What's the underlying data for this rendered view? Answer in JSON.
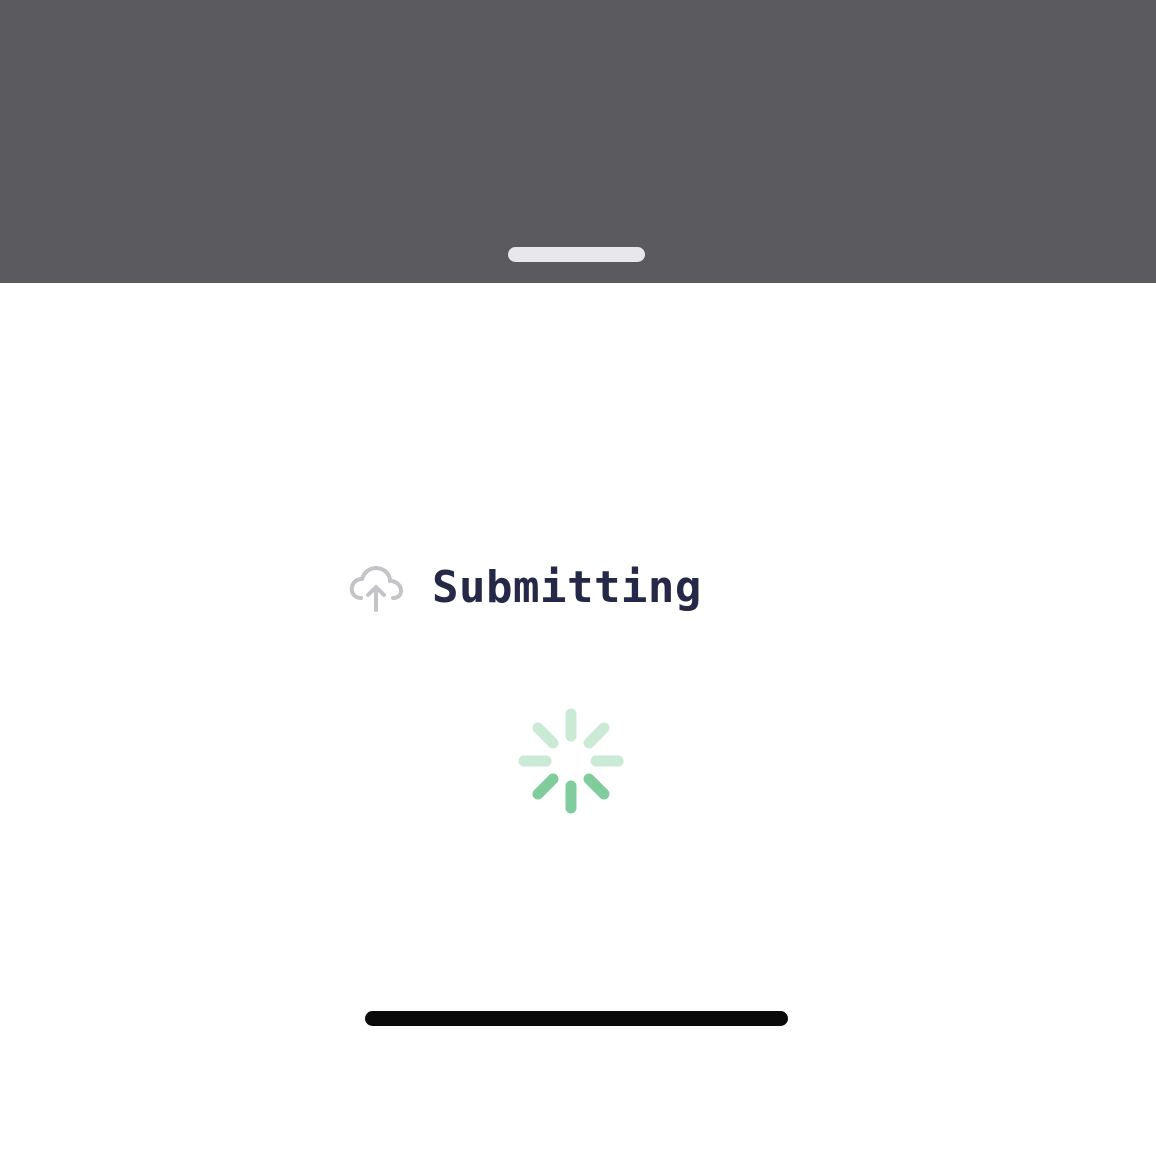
{
  "app": {
    "status_text": "Submitting"
  },
  "icons": {
    "status_icon": "cloud-upload-icon",
    "loading_icon": "spinner-icon"
  },
  "colors": {
    "backdrop": "#5b5a5e",
    "grabber": "#e8e8ea",
    "sheet": "#ffffff",
    "text": "#252846",
    "icon": "#c4c4c8",
    "spinner": "#6cc48c",
    "home_indicator": "#0a0a0a"
  }
}
